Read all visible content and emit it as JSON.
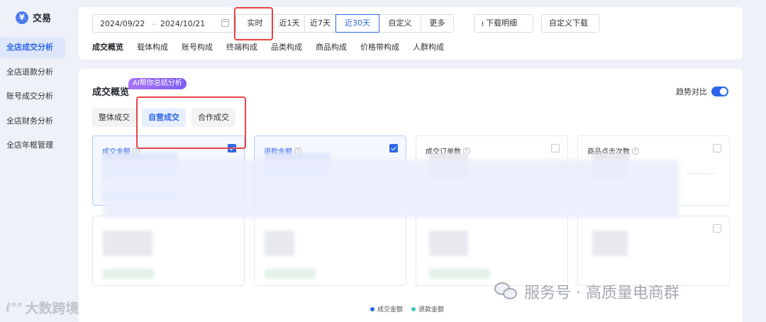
{
  "sidebar": {
    "brand_logo": "¥",
    "brand_name": "交易",
    "items": [
      {
        "label": "全店成交分析",
        "active": true
      },
      {
        "label": "全店退款分析",
        "active": false
      },
      {
        "label": "账号成交分析",
        "active": false
      },
      {
        "label": "全店财务分析",
        "active": false
      },
      {
        "label": "全店年框管理",
        "active": false
      }
    ]
  },
  "toolbar": {
    "date_start": "2024/09/22",
    "date_sep": "–",
    "date_end": "2024/10/21",
    "range_buttons": [
      "实时",
      "近1天",
      "近7天",
      "近30天",
      "自定义",
      "更多"
    ],
    "range_active": "近30天",
    "download_detail": "下载明细",
    "custom_download": "自定义下载",
    "sub_tabs": [
      "成交概览",
      "载体构成",
      "账号构成",
      "终端构成",
      "品类构成",
      "商品构成",
      "价格带构成",
      "人群构成"
    ],
    "sub_tab_active": "成交概览"
  },
  "overview": {
    "title": "成交概览",
    "ai_badge": "AI帮你总结分析",
    "trend_label": "趋势对比",
    "trend_on": true,
    "segments": [
      "整体成交",
      "自营成交",
      "合作成交"
    ],
    "segment_active": "自营成交",
    "cards_row1": [
      {
        "title": "成交金额",
        "checked": true,
        "selected": true
      },
      {
        "title": "退款金额",
        "checked": true,
        "selected": true
      },
      {
        "title": "成交订单数",
        "checked": false,
        "selected": false
      },
      {
        "title": "商品点击次数",
        "checked": false,
        "selected": false
      }
    ],
    "legend": [
      {
        "label": "成交金额",
        "color": "#2d66e8"
      },
      {
        "label": "退款金额",
        "color": "#3ec7b7"
      }
    ]
  },
  "watermarks": {
    "left": "大数跨境",
    "right": "服务号 · 高质量电商群"
  },
  "colors": {
    "accent": "#2d66e8",
    "highlight": "#e54545"
  }
}
